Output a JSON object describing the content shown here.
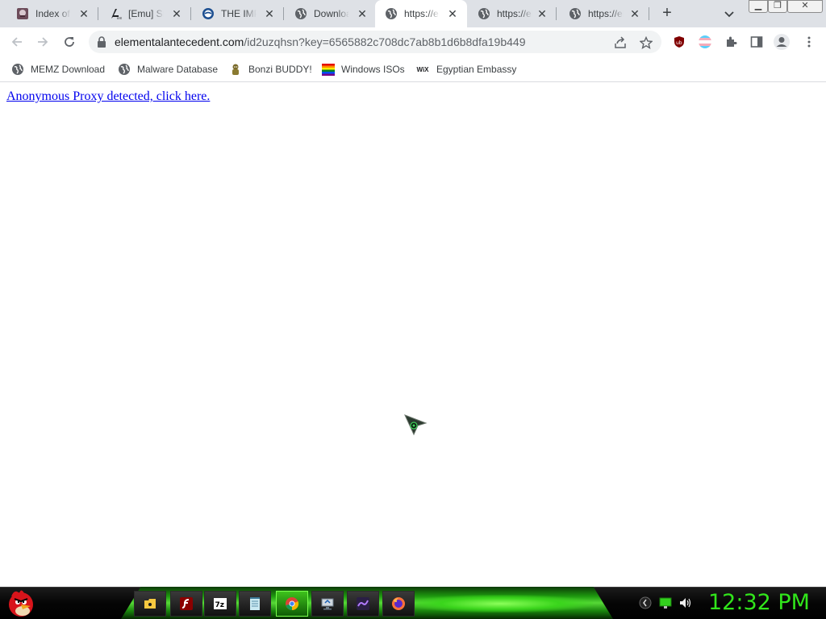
{
  "browser": {
    "tabs": [
      {
        "title": "Index of /",
        "icon": "trollface-icon",
        "active": false
      },
      {
        "title": "[Emu] Sm",
        "icon": "pokemon-emu-icon",
        "active": false
      },
      {
        "title": "THE IMPO",
        "icon": "blue-circle-icon",
        "active": false
      },
      {
        "title": "Downloa",
        "icon": "globe-icon",
        "active": false
      },
      {
        "title": "https://el",
        "icon": "globe-icon",
        "active": true
      },
      {
        "title": "https://el",
        "icon": "globe-icon",
        "active": false
      },
      {
        "title": "https://el",
        "icon": "globe-icon",
        "active": false
      }
    ],
    "address": {
      "host": "elementalantecedent.com",
      "path": "/id2uzqhsn?key=6565882c708dc7ab8b1d6b8dfa19b449"
    },
    "bookmarks": [
      {
        "label": "MEMZ Download",
        "icon": "globe-icon"
      },
      {
        "label": "Malware Database",
        "icon": "globe-icon"
      },
      {
        "label": "Bonzi BUDDY!",
        "icon": "bonzi-icon"
      },
      {
        "label": "Windows ISOs",
        "icon": "rainbow-flag-icon"
      },
      {
        "label": "Egyptian Embassy",
        "icon": "wix-icon"
      }
    ],
    "wix_label": "WiX"
  },
  "page": {
    "link_text": "Anonymous Proxy detected, click here."
  },
  "taskbar": {
    "clock": "12:32 PM",
    "accent_color": "#31e51b"
  }
}
